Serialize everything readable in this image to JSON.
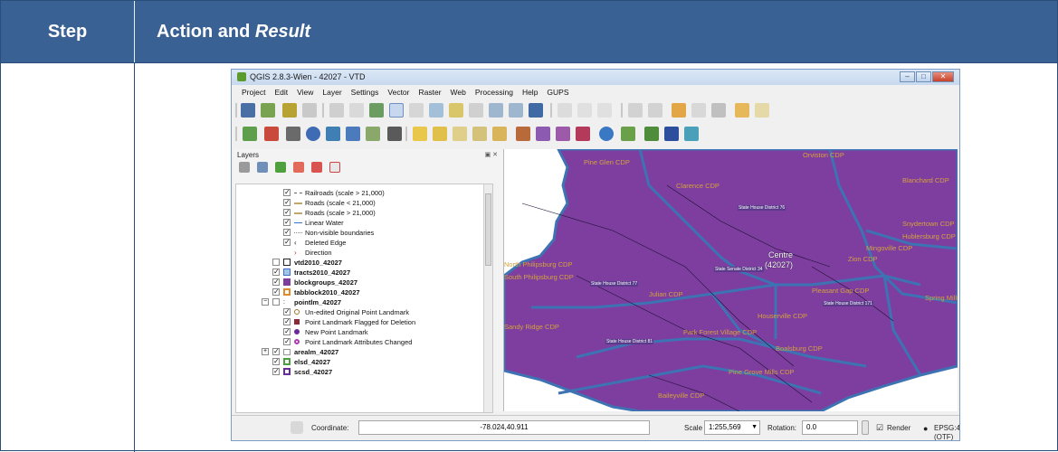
{
  "header": {
    "step_label": "Step",
    "action_label": "Action and ",
    "action_italic": "Result"
  },
  "window": {
    "title": "QGIS 2.8.3-Wien - 42027 - VTD"
  },
  "menu": [
    "Project",
    "Edit",
    "View",
    "Layer",
    "Settings",
    "Vector",
    "Raster",
    "Web",
    "Processing",
    "Help",
    "GUPS"
  ],
  "layers_panel": {
    "title": "Layers",
    "items": [
      {
        "label": "Railroads (scale > 21,000)",
        "bold": false
      },
      {
        "label": "Roads (scale < 21,000)",
        "bold": false
      },
      {
        "label": "Roads (scale > 21,000)",
        "bold": false
      },
      {
        "label": "Linear Water",
        "bold": false
      },
      {
        "label": "Non-visible boundaries",
        "bold": false
      },
      {
        "label": "Deleted Edge",
        "bold": false
      },
      {
        "label": "Direction",
        "bold": false
      },
      {
        "label": "vtd2010_42027",
        "bold": true
      },
      {
        "label": "tracts2010_42027",
        "bold": true
      },
      {
        "label": "blockgroups_42027",
        "bold": true
      },
      {
        "label": "tabblock2010_42027",
        "bold": true
      },
      {
        "label": "pointlm_42027",
        "bold": true
      },
      {
        "label": "Un-edited Original Point Landmark",
        "bold": false
      },
      {
        "label": "Point Landmark Flagged for Deletion",
        "bold": false
      },
      {
        "label": "New Point Landmark",
        "bold": false
      },
      {
        "label": "Point Landmark Attributes Changed",
        "bold": false
      },
      {
        "label": "arealm_42027",
        "bold": true
      },
      {
        "label": "elsd_42027",
        "bold": true
      },
      {
        "label": "scsd_42027",
        "bold": true
      }
    ]
  },
  "map": {
    "labels": [
      "Pine Glen CDP",
      "Orviston CDP",
      "Clarence CDP",
      "Blanchard CDP",
      "State House District 76",
      "Snydertown CDP",
      "Hublersburg CDP",
      "Mingoville CDP",
      "Zion CDP",
      "North Philipsburg CDP",
      "South Philipsburg CDP",
      "Centre",
      "(42027)",
      "State Senate District 34",
      "State House District 77",
      "Julian CDP",
      "Pleasant Gap CDP",
      "Spring Mills",
      "State House District 171",
      "Houserville CDP",
      "Sandy Ridge CDP",
      "Park Forest Village CDP",
      "State House District 81",
      "Boalsburg CDP",
      "Pine Grove Mills CDP",
      "Baileyville CDP"
    ],
    "fill_color": "#7d3ea0",
    "boundary_color": "#3d73b3"
  },
  "status": {
    "coordinate_label": "Coordinate:",
    "coordinate_value": "-78.024,40.911",
    "scale_label": "Scale",
    "scale_value": "1:255,569",
    "rotation_label": "Rotation:",
    "rotation_value": "0.0",
    "render_label": "Render",
    "crs_label": "EPSG:4269 (OTF)"
  }
}
